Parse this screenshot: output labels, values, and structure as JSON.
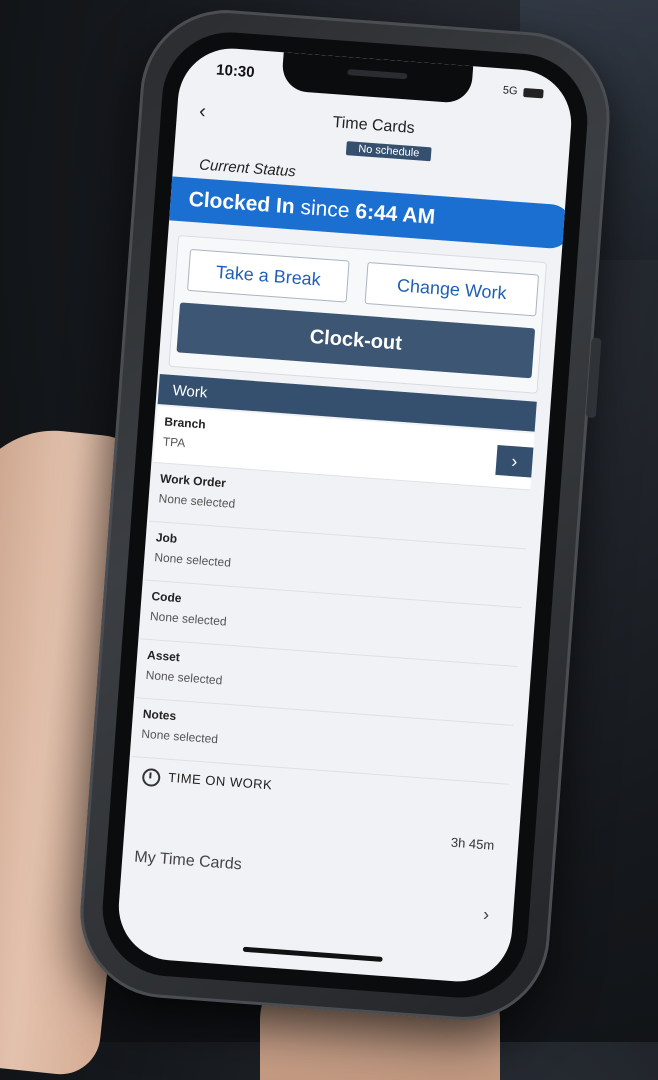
{
  "status_bar": {
    "time": "10:30",
    "network": "5G"
  },
  "header": {
    "back_icon": "chevron-left-icon",
    "title": "Time Cards",
    "badge": "No schedule"
  },
  "current_status": {
    "label": "Current Status",
    "state": "Clocked In",
    "since_word": "since",
    "since_time": "6:44 AM"
  },
  "actions": {
    "take_break": "Take a Break",
    "change_work": "Change Work",
    "clock_out": "Clock-out"
  },
  "work": {
    "header": "Work",
    "fields": [
      {
        "label": "Branch",
        "value": "TPA"
      },
      {
        "label": "Work Order",
        "value": "None selected"
      },
      {
        "label": "Job",
        "value": "None selected"
      },
      {
        "label": "Code",
        "value": "None selected"
      },
      {
        "label": "Asset",
        "value": "None selected"
      },
      {
        "label": "Notes",
        "value": "None selected"
      }
    ]
  },
  "time_on_work": {
    "label": "TIME ON WORK",
    "value": "3h 45m"
  },
  "my_time_cards": {
    "label": "My Time Cards"
  },
  "colors": {
    "primary_blue": "#1b6fd0",
    "navy": "#35506f",
    "button_text": "#1f5fb5"
  }
}
